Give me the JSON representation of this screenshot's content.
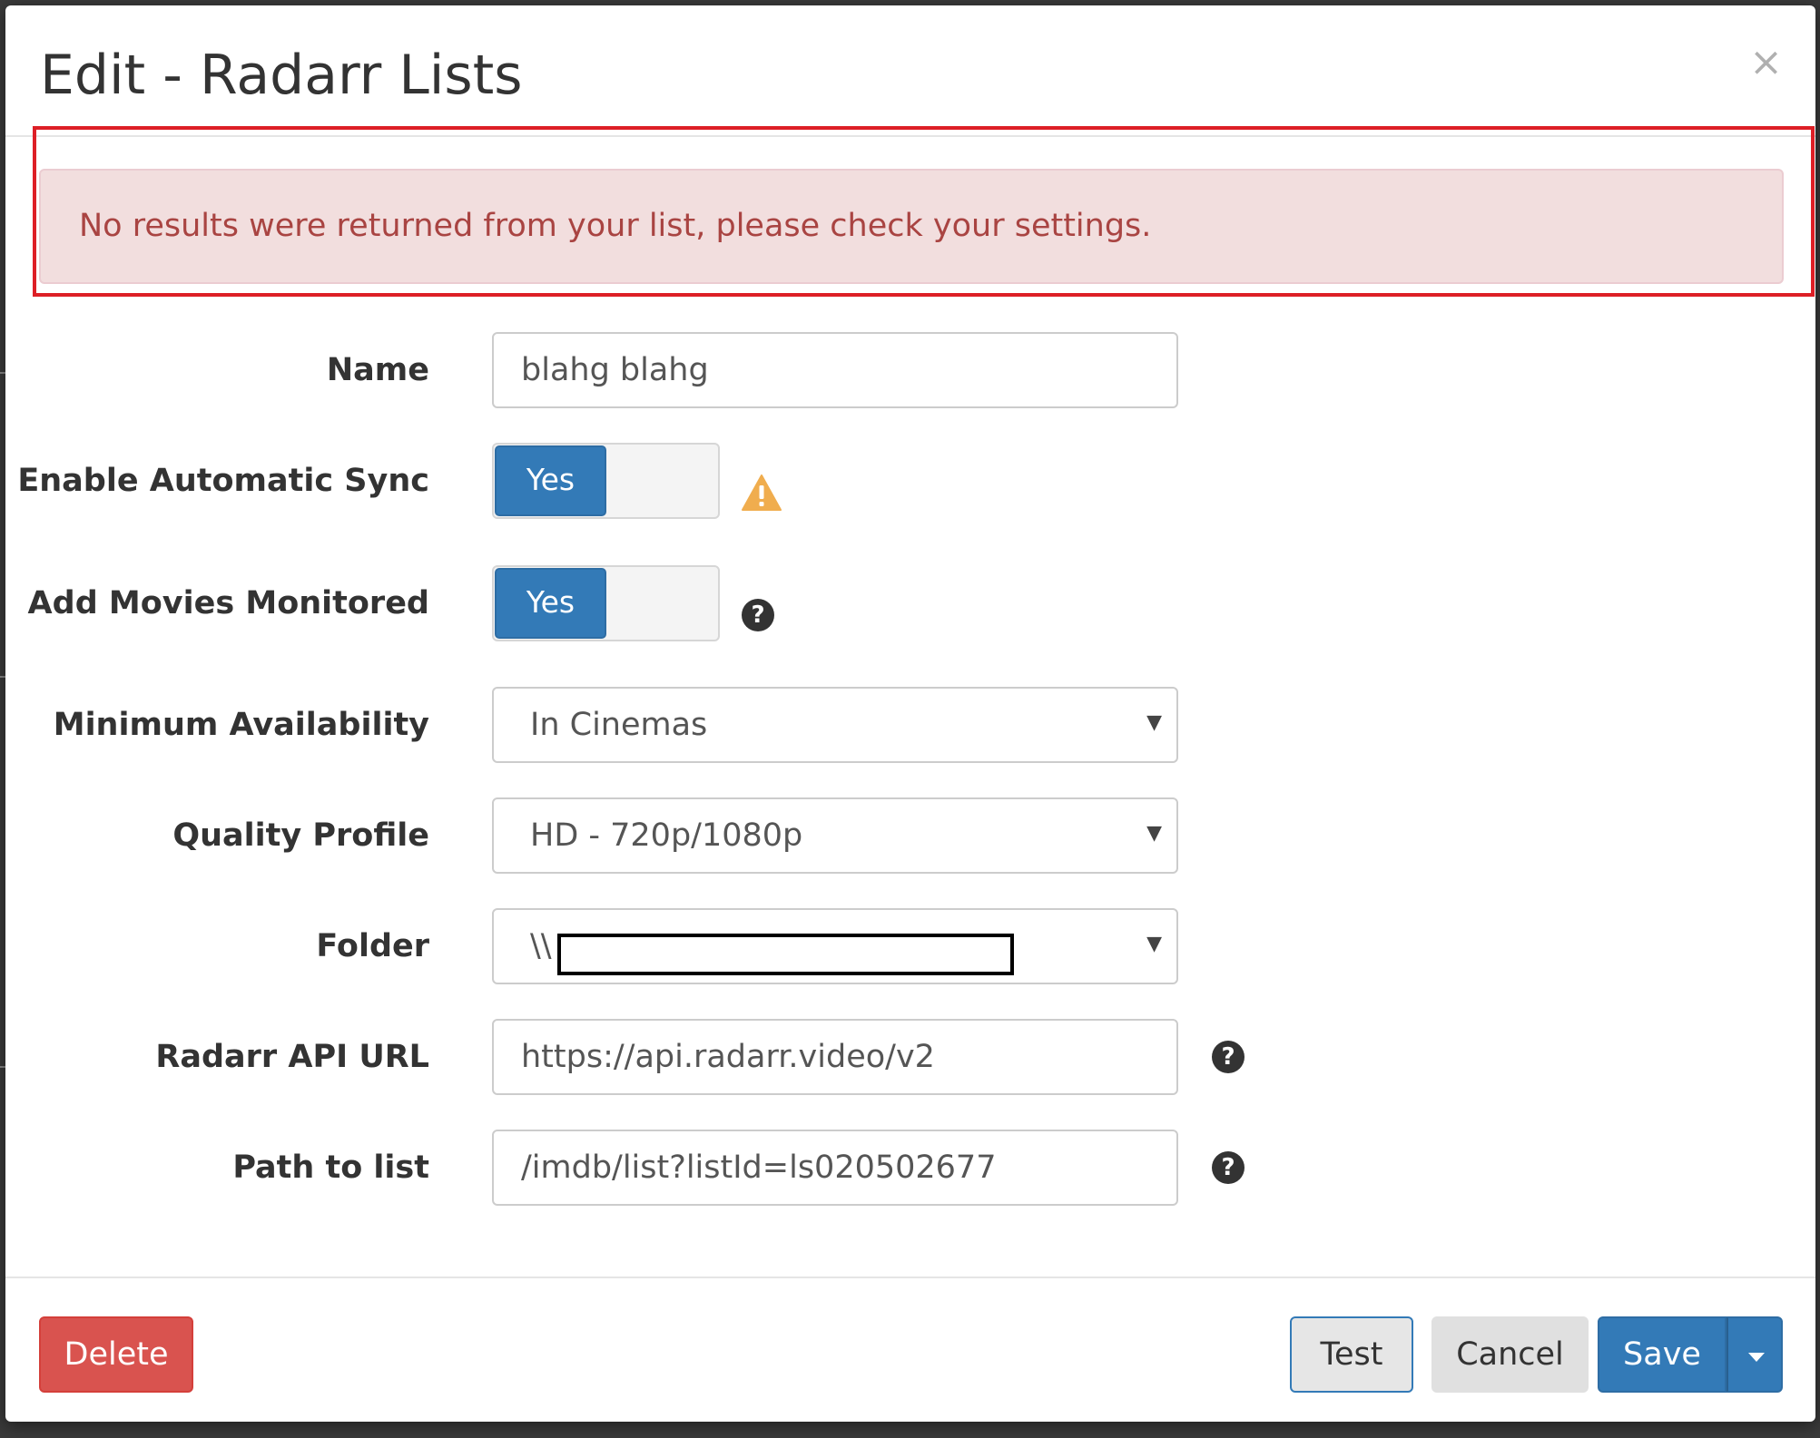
{
  "modal": {
    "title": "Edit - Radarr Lists",
    "close_symbol": "×"
  },
  "alert": {
    "message": "No results were returned from your list, please check your settings."
  },
  "form": {
    "name": {
      "label": "Name",
      "value": "blahg blahg"
    },
    "enable_automatic_sync": {
      "label": "Enable Automatic Sync",
      "toggle_label": "Yes",
      "icon": "warning-icon"
    },
    "add_movies_monitored": {
      "label": "Add Movies Monitored",
      "toggle_label": "Yes",
      "icon": "help-icon"
    },
    "minimum_availability": {
      "label": "Minimum Availability",
      "selected": "In Cinemas"
    },
    "quality_profile": {
      "label": "Quality Profile",
      "selected": "HD - 720p/1080p"
    },
    "folder": {
      "label": "Folder",
      "selected_prefix": "\\\\"
    },
    "radarr_api_url": {
      "label": "Radarr API URL",
      "value": "https://api.radarr.video/v2",
      "icon": "help-icon"
    },
    "path_to_list": {
      "label": "Path to list",
      "value": "/imdb/list?listId=ls020502677",
      "icon": "help-icon"
    }
  },
  "footer": {
    "delete_label": "Delete",
    "test_label": "Test",
    "cancel_label": "Cancel",
    "save_label": "Save"
  },
  "colors": {
    "primary": "#337ab7",
    "danger": "#d9534f",
    "alert_bg": "#f2dede",
    "alert_text": "#a94442",
    "highlight_frame": "#dd1f26",
    "warning": "#f0ad4e"
  }
}
